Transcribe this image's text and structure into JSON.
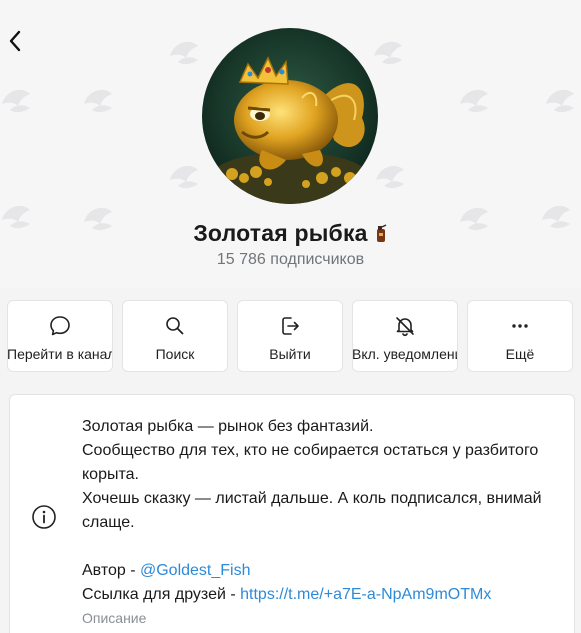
{
  "channel": {
    "title": "Золотая рыбка",
    "title_emoji": "🧯",
    "subscribers": "15 786 подписчиков"
  },
  "actions": [
    {
      "label": "Перейти в канал",
      "icon": "chat-bubble-icon"
    },
    {
      "label": "Поиск",
      "icon": "search-icon"
    },
    {
      "label": "Выйти",
      "icon": "exit-icon"
    },
    {
      "label": "Вкл. уведомления",
      "icon": "bell-off-icon"
    },
    {
      "label": "Ещё",
      "icon": "more-dots-icon"
    }
  ],
  "description": {
    "line1": "Золотая рыбка — рынок без фантазий.",
    "line2": "Сообщество для тех, кто не собирается остаться у разбитого корыта.",
    "line3": "Хочешь сказку — листай дальше. А коль подписался, внимай слаще.",
    "author_prefix": "Автор - ",
    "author_link": "@Goldest_Fish",
    "friends_prefix": "Ссылка для друзей - ",
    "friends_link": "https://t.me/+a7E-a-NpAm9mOTMx",
    "label": "Описание"
  },
  "colors": {
    "accent": "#2e8ad8",
    "muted": "#707579",
    "background": "#f4f4f5"
  }
}
